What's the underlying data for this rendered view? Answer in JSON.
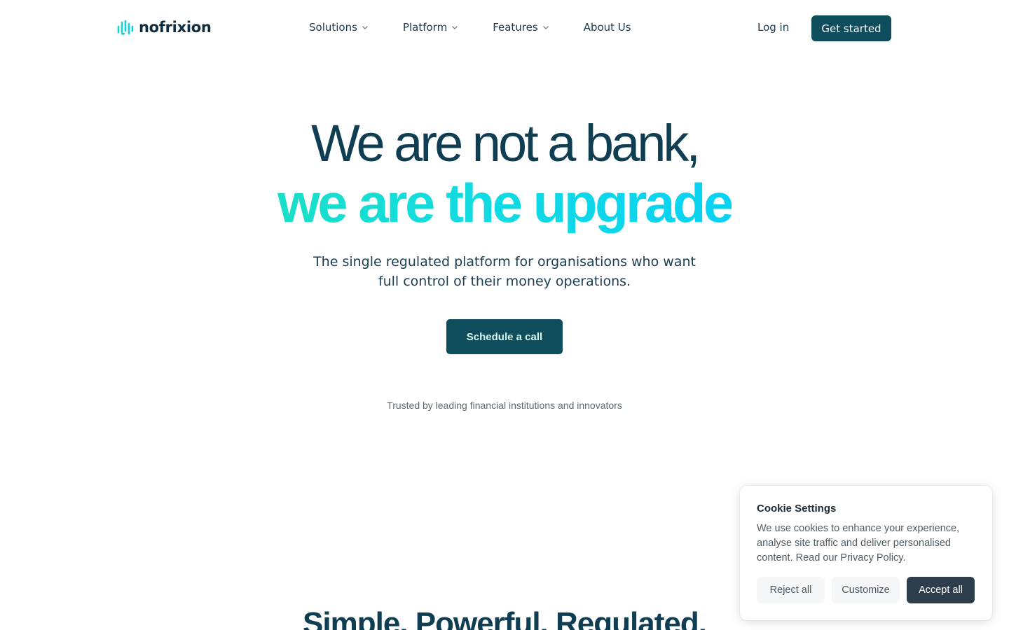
{
  "header": {
    "logo_text": "nofrixion",
    "nav": [
      {
        "label": "Solutions",
        "has_dropdown": true
      },
      {
        "label": "Platform",
        "has_dropdown": true
      },
      {
        "label": "Features",
        "has_dropdown": true
      },
      {
        "label": "About Us",
        "has_dropdown": false
      }
    ],
    "login_label": "Log in",
    "get_started_label": "Get started"
  },
  "hero": {
    "line1": "We are not a bank,",
    "line2": "we are the upgrade",
    "subtitle_line1": "The single regulated platform for organisations who want",
    "subtitle_line2": "full control of their money operations.",
    "cta_label": "Schedule a call",
    "trusted_text": "Trusted by leading financial institutions and innovators"
  },
  "next_section": {
    "title": "Simple. Powerful. Regulated."
  },
  "cookie": {
    "title": "Cookie Settings",
    "text": "We use cookies to enhance your experience, analyse site traffic and deliver personalised content. Read our Privacy Policy.",
    "reject_label": "Reject all",
    "customize_label": "Customize",
    "accept_label": "Accept all"
  },
  "colors": {
    "brand_dark": "#0f4c5c",
    "brand_gradient_start": "#19dfc8",
    "brand_gradient_end": "#08d2f2",
    "cookie_accept": "#2e3d4c"
  },
  "icons": {
    "logo": "nofrixion-wave-logo-icon",
    "dropdown": "chevron-down-icon"
  }
}
